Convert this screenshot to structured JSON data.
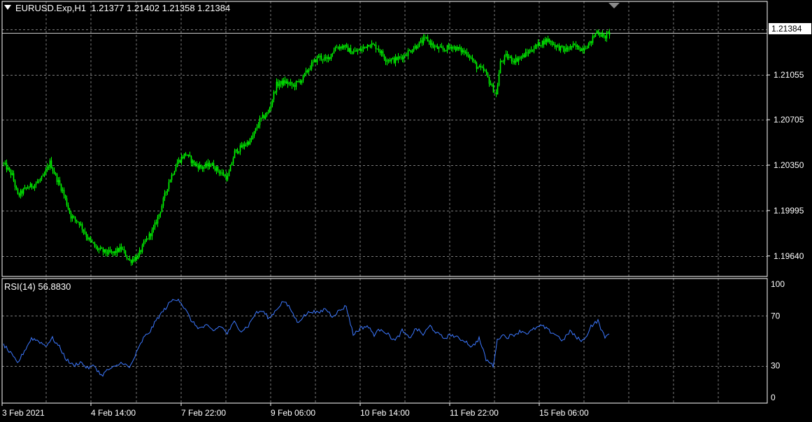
{
  "header": {
    "symbol": "EURUSD.Exp,H1",
    "ohlc": "1.21377 1.21402 1.21358 1.21384"
  },
  "rsi_panel": {
    "label": "RSI(14) 56.8830"
  },
  "current_price": "1.21384",
  "colors": {
    "background": "#000000",
    "grid": "#7a7a7a",
    "candle": "#00ff00",
    "rsi_line": "#3c78ff",
    "axis_text": "#ffffff"
  },
  "chart_data": [
    {
      "type": "candlestick",
      "symbol": "EURUSD.Exp",
      "timeframe": "H1",
      "price_ticks": [
        "1.21055",
        "1.20705",
        "1.20350",
        "1.19995",
        "1.19640"
      ],
      "price_tick_values": [
        1.21055,
        1.20705,
        1.2035,
        1.19995,
        1.1964
      ],
      "ylim": [
        1.1948,
        1.2163
      ],
      "time_labels": [
        "3 Feb 2021",
        "4 Feb 14:00",
        "7 Feb 22:00",
        "9 Feb 06:00",
        "10 Feb 14:00",
        "11 Feb 22:00",
        "15 Feb 06:00"
      ],
      "close_anchors": [
        [
          0,
          1.2036
        ],
        [
          6,
          1.2027
        ],
        [
          10,
          1.2011
        ],
        [
          16,
          1.2017
        ],
        [
          22,
          1.202
        ],
        [
          28,
          1.2025
        ],
        [
          33,
          1.2037
        ],
        [
          38,
          1.2024
        ],
        [
          42,
          1.2015
        ],
        [
          48,
          1.1995
        ],
        [
          54,
          1.199
        ],
        [
          60,
          1.1978
        ],
        [
          66,
          1.197
        ],
        [
          72,
          1.1967
        ],
        [
          78,
          1.1966
        ],
        [
          84,
          1.197
        ],
        [
          90,
          1.196
        ],
        [
          96,
          1.1964
        ],
        [
          101,
          1.1975
        ],
        [
          107,
          1.1985
        ],
        [
          112,
          1.2
        ],
        [
          118,
          1.2022
        ],
        [
          124,
          1.2037
        ],
        [
          130,
          1.2044
        ],
        [
          136,
          1.2036
        ],
        [
          142,
          1.2033
        ],
        [
          148,
          1.2036
        ],
        [
          154,
          1.203
        ],
        [
          160,
          1.2025
        ],
        [
          165,
          1.2045
        ],
        [
          171,
          1.205
        ],
        [
          177,
          1.2055
        ],
        [
          183,
          1.207
        ],
        [
          189,
          1.2076
        ],
        [
          195,
          1.2098
        ],
        [
          201,
          1.21
        ],
        [
          207,
          1.2097
        ],
        [
          213,
          1.2102
        ],
        [
          219,
          1.2112
        ],
        [
          225,
          1.212
        ],
        [
          231,
          1.2117
        ],
        [
          237,
          1.2127
        ],
        [
          243,
          1.2128
        ],
        [
          249,
          1.2123
        ],
        [
          255,
          1.2125
        ],
        [
          261,
          1.213
        ],
        [
          267,
          1.2127
        ],
        [
          273,
          1.2118
        ],
        [
          279,
          1.2117
        ],
        [
          285,
          1.212
        ],
        [
          291,
          1.2125
        ],
        [
          297,
          1.213
        ],
        [
          302,
          1.2134
        ],
        [
          308,
          1.2127
        ],
        [
          314,
          1.2125
        ],
        [
          320,
          1.2128
        ],
        [
          326,
          1.2125
        ],
        [
          332,
          1.2122
        ],
        [
          338,
          1.2112
        ],
        [
          344,
          1.2108
        ],
        [
          348,
          1.2098
        ],
        [
          352,
          1.209
        ],
        [
          355,
          1.2115
        ],
        [
          359,
          1.212
        ],
        [
          365,
          1.2117
        ],
        [
          371,
          1.212
        ],
        [
          377,
          1.2125
        ],
        [
          383,
          1.213
        ],
        [
          389,
          1.2133
        ],
        [
          395,
          1.2128
        ],
        [
          401,
          1.2125
        ],
        [
          407,
          1.2128
        ],
        [
          413,
          1.2126
        ],
        [
          419,
          1.213
        ],
        [
          424,
          1.214
        ],
        [
          429,
          1.2135
        ],
        [
          433,
          1.2138
        ]
      ]
    },
    {
      "type": "line",
      "name": "RSI(14)",
      "last_value": 56.883,
      "ylim": [
        0,
        100
      ],
      "ticks": [
        "100",
        "70",
        "30",
        "0"
      ],
      "tick_values": [
        100,
        70,
        30,
        0
      ],
      "levels": [
        70,
        30
      ],
      "anchors": [
        [
          0,
          47
        ],
        [
          5,
          40
        ],
        [
          10,
          32
        ],
        [
          15,
          42
        ],
        [
          20,
          52
        ],
        [
          25,
          50
        ],
        [
          30,
          46
        ],
        [
          35,
          52
        ],
        [
          40,
          45
        ],
        [
          45,
          35
        ],
        [
          50,
          30
        ],
        [
          55,
          33
        ],
        [
          60,
          28
        ],
        [
          65,
          30
        ],
        [
          70,
          22
        ],
        [
          75,
          27
        ],
        [
          80,
          29
        ],
        [
          85,
          33
        ],
        [
          90,
          28
        ],
        [
          95,
          40
        ],
        [
          100,
          52
        ],
        [
          105,
          58
        ],
        [
          110,
          68
        ],
        [
          115,
          75
        ],
        [
          120,
          82
        ],
        [
          125,
          84
        ],
        [
          130,
          75
        ],
        [
          135,
          65
        ],
        [
          140,
          60
        ],
        [
          145,
          62
        ],
        [
          150,
          58
        ],
        [
          155,
          62
        ],
        [
          160,
          56
        ],
        [
          165,
          65
        ],
        [
          170,
          58
        ],
        [
          175,
          62
        ],
        [
          180,
          72
        ],
        [
          185,
          74
        ],
        [
          190,
          68
        ],
        [
          195,
          75
        ],
        [
          200,
          82
        ],
        [
          205,
          76
        ],
        [
          210,
          65
        ],
        [
          215,
          70
        ],
        [
          220,
          74
        ],
        [
          225,
          72
        ],
        [
          230,
          76
        ],
        [
          235,
          70
        ],
        [
          240,
          74
        ],
        [
          245,
          78
        ],
        [
          250,
          55
        ],
        [
          255,
          60
        ],
        [
          260,
          62
        ],
        [
          265,
          55
        ],
        [
          270,
          60
        ],
        [
          275,
          55
        ],
        [
          280,
          50
        ],
        [
          285,
          58
        ],
        [
          290,
          52
        ],
        [
          295,
          60
        ],
        [
          300,
          55
        ],
        [
          305,
          62
        ],
        [
          310,
          56
        ],
        [
          315,
          52
        ],
        [
          320,
          55
        ],
        [
          325,
          52
        ],
        [
          330,
          50
        ],
        [
          335,
          45
        ],
        [
          340,
          52
        ],
        [
          345,
          35
        ],
        [
          350,
          30
        ],
        [
          353,
          50
        ],
        [
          356,
          55
        ],
        [
          360,
          53
        ],
        [
          365,
          55
        ],
        [
          370,
          58
        ],
        [
          375,
          56
        ],
        [
          380,
          60
        ],
        [
          385,
          62
        ],
        [
          390,
          58
        ],
        [
          395,
          55
        ],
        [
          400,
          50
        ],
        [
          405,
          58
        ],
        [
          410,
          52
        ],
        [
          415,
          50
        ],
        [
          420,
          62
        ],
        [
          425,
          66
        ],
        [
          430,
          52
        ],
        [
          433,
          57
        ]
      ],
      "time_labels": [
        "3 Feb 2021",
        "4 Feb 14:00",
        "7 Feb 22:00",
        "9 Feb 06:00",
        "10 Feb 14:00",
        "11 Feb 22:00",
        "15 Feb 06:00"
      ]
    }
  ]
}
